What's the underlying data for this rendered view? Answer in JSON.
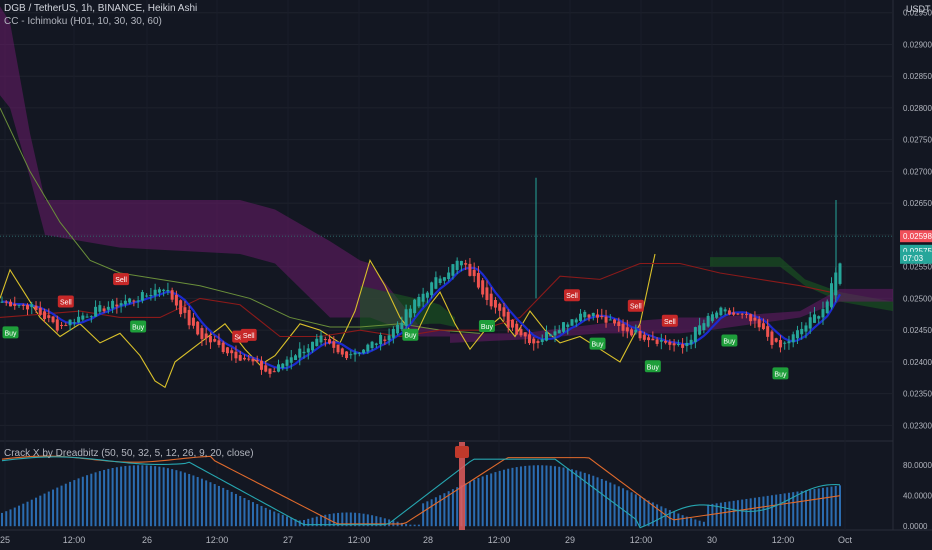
{
  "header": {
    "symbol_line": "DGB / TetherUS, 1h, BINANCE, Heikin Ashi",
    "ichimoku_line": "CC - Ichimoku (H01, 10, 30, 30, 60)",
    "oscillator_line": "Crack X by Dreadbitz (50, 50, 32, 5, 12, 26, 9, 20, close)",
    "currency": "USDT"
  },
  "colors": {
    "background": "#131722",
    "bull": "#26a69a",
    "bear": "#ef5350",
    "cloud_bear": "#6a1b6a",
    "cloud_bull": "#1b5e20",
    "price_line": "#f0505a",
    "last_badge": "#26a69a",
    "buy_label": "#1e9e3a",
    "sell_label": "#c62828",
    "baseline": "#1c2bd1",
    "conversion": "#8b1a1a",
    "lagging_yellow": "#d9c02a",
    "lagging_green": "#6a8f3a",
    "histogram": "#2b6cb0",
    "osc_orange": "#e06a2c",
    "osc_teal": "#26a6b0"
  },
  "chart_data": [
    {
      "type": "candlestick",
      "title": "DGB / TetherUS, 1h, BINANCE, Heikin Ashi",
      "x_ticks": [
        "25",
        "12:00",
        "26",
        "12:00",
        "27",
        "12:00",
        "28",
        "12:00",
        "29",
        "12:00",
        "30",
        "12:00",
        "Oct"
      ],
      "y_ticks": [
        "0.02950",
        "0.02900",
        "0.02850",
        "0.02800",
        "0.02750",
        "0.02700",
        "0.02650",
        "0.02600",
        "0.02550",
        "0.02500",
        "0.02450",
        "0.02400",
        "0.02350",
        "0.02300"
      ],
      "ylim": [
        0.02277,
        0.0297
      ],
      "price_badges": [
        {
          "text": "0.02598",
          "value": 0.02598,
          "color": "#f0505a"
        },
        {
          "text": "0.02575",
          "value": 0.02575,
          "color": "#26a69a"
        },
        {
          "text": "07:03",
          "value": 0.02564,
          "color": "#26a69a"
        }
      ],
      "signals": [
        {
          "label": "Buy",
          "candle": 2
        },
        {
          "label": "Sell",
          "candle": 15
        },
        {
          "label": "Sell",
          "candle": 28
        },
        {
          "label": "Buy",
          "candle": 32
        },
        {
          "label": "Sell",
          "candle": 56
        },
        {
          "label": "Sell",
          "candle": 58
        },
        {
          "label": "Buy",
          "candle": 96
        },
        {
          "label": "Buy",
          "candle": 114
        },
        {
          "label": "Sell",
          "candle": 134
        },
        {
          "label": "Buy",
          "candle": 140
        },
        {
          "label": "Sell",
          "candle": 149
        },
        {
          "label": "Buy",
          "candle": 153
        },
        {
          "label": "Sell",
          "candle": 157
        },
        {
          "label": "Buy",
          "candle": 171
        },
        {
          "label": "Buy",
          "candle": 183
        }
      ]
    },
    {
      "type": "bar",
      "title": "Crack X by Dreadbitz (50, 50, 32, 5, 12, 26, 9, 20, close)",
      "y_ticks": [
        "80.0000",
        "40.0000",
        "0.0000"
      ],
      "ylim": [
        -5,
        100
      ]
    }
  ]
}
